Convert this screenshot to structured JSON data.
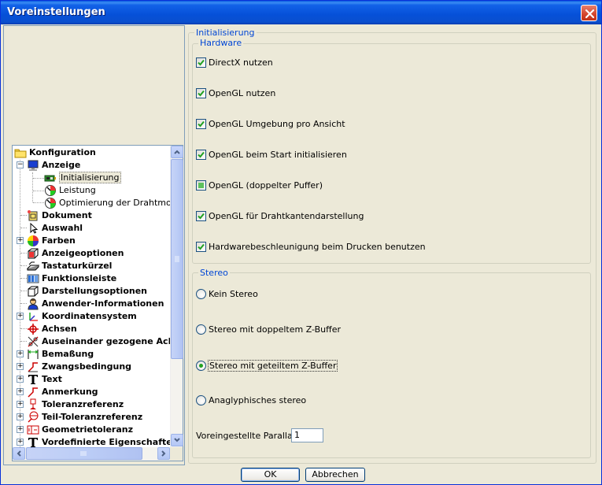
{
  "window": {
    "title": "Voreinstellungen"
  },
  "tree": {
    "items": [
      {
        "label": "Konfiguration",
        "icon": "folder-icon"
      },
      {
        "label": "Anzeige",
        "icon": "monitor-icon"
      },
      {
        "label": "Initialisierung",
        "icon": "graphics-card-icon",
        "selected": true
      },
      {
        "label": "Leistung",
        "icon": "gauge-icon"
      },
      {
        "label": "Optimierung der Drahtmodelld",
        "icon": "gauge-icon"
      },
      {
        "label": "Dokument",
        "icon": "document-icon"
      },
      {
        "label": "Auswahl",
        "icon": "cursor-icon"
      },
      {
        "label": "Farben",
        "icon": "color-wheel-icon"
      },
      {
        "label": "Anzeigeoptionen",
        "icon": "box-icon"
      },
      {
        "label": "Tastaturkürzel",
        "icon": "keyboard-icon"
      },
      {
        "label": "Funktionsleiste",
        "icon": "toolbar-icon"
      },
      {
        "label": "Darstellungsoptionen",
        "icon": "cube-icon"
      },
      {
        "label": "Anwender-Informationen",
        "icon": "user-icon"
      },
      {
        "label": "Koordinatensystem",
        "icon": "axes-icon"
      },
      {
        "label": "Achsen",
        "icon": "crosshair-icon"
      },
      {
        "label": "Auseinander gezogene Achs",
        "icon": "exploded-axes-icon"
      },
      {
        "label": "Bemaßung",
        "icon": "dimension-icon"
      },
      {
        "label": "Zwangsbedingung",
        "icon": "constraint-icon"
      },
      {
        "label": "Text",
        "icon": "text-icon"
      },
      {
        "label": "Anmerkung",
        "icon": "annotation-icon"
      },
      {
        "label": "Toleranzreferenz",
        "icon": "datum-icon"
      },
      {
        "label": "Teil-Toleranzreferenz",
        "icon": "datum-target-icon"
      },
      {
        "label": "Geometrietoleranz",
        "icon": "tolerance-icon"
      },
      {
        "label": "Vordefinierte Eigenschaften",
        "icon": "text-icon"
      }
    ]
  },
  "init": {
    "group_label": "Initialisierung",
    "hardware": {
      "label": "Hardware",
      "options": [
        {
          "label": "DirectX nutzen",
          "checked": true
        },
        {
          "label": "OpenGL nutzen",
          "checked": true
        },
        {
          "label": "OpenGL Umgebung pro Ansicht",
          "checked": true
        },
        {
          "label": "OpenGL beim Start initialisieren",
          "checked": true
        },
        {
          "label": "OpenGL (doppelter Puffer)",
          "checked": "indeterminate"
        },
        {
          "label": "OpenGL für Drahtkantendarstellung",
          "checked": true
        },
        {
          "label": "Hardwarebeschleunigung beim Drucken benutzen",
          "checked": true
        }
      ]
    },
    "stereo": {
      "label": "Stereo",
      "options": [
        {
          "label": "Kein Stereo",
          "selected": false
        },
        {
          "label": "Stereo mit doppeltem Z-Buffer",
          "selected": false
        },
        {
          "label": "Stereo mit geteiltem Z-Buffer",
          "selected": true
        },
        {
          "label": "Anaglyphisches stereo",
          "selected": false
        }
      ],
      "parallax_label": "Voreingestellte Parallaxe :",
      "parallax_value": "1"
    }
  },
  "buttons": {
    "ok": "OK",
    "cancel": "Abbrechen"
  },
  "colors": {
    "titlebar": "#0a5ae2",
    "accent_text": "#0046d5",
    "check": "#21a121"
  }
}
